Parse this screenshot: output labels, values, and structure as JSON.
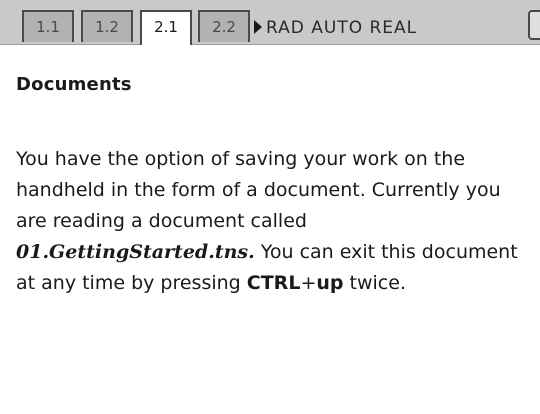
{
  "tabs": [
    {
      "label": "1.1",
      "active": false
    },
    {
      "label": "1.2",
      "active": false
    },
    {
      "label": "2.1",
      "active": true
    },
    {
      "label": "2.2",
      "active": false
    }
  ],
  "status": {
    "mode": "RAD AUTO REAL",
    "battery_icon": "battery-icon"
  },
  "document": {
    "heading": "Documents",
    "p1": "You have the option of saving your work on the handheld in the form of a document. Currently you are reading a document called ",
    "doc_name": "01.GettingStarted.tns.",
    "p2": " You can exit this document at any time by pressing ",
    "key_ctrl": "CTRL",
    "plus": "+",
    "key_up": "up",
    "p3": " twice."
  },
  "colors": {
    "bar_bg": "#c9c9c9",
    "tab_bg": "#b2b2b2",
    "active_tab_bg": "#ffffff",
    "text": "#1a1a1a"
  }
}
